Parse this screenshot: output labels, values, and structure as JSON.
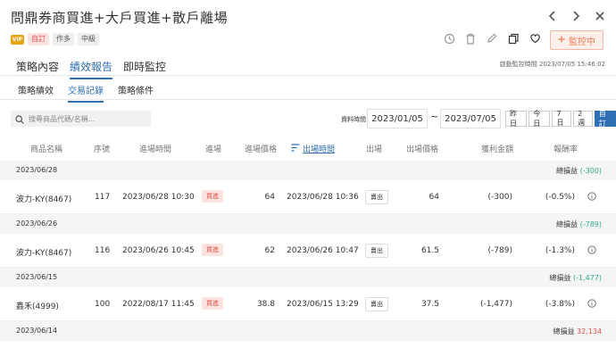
{
  "header": {
    "title": "問鼎券商買進+大戶買進+散戶離場",
    "prev_icon": "chevron-left-icon",
    "next_icon": "chevron-right-icon",
    "close_icon": "close-icon"
  },
  "tags": {
    "vip": "VIP",
    "custom": "自訂",
    "author": "作多",
    "level": "中級"
  },
  "actions": {
    "monitor_label": "監控中",
    "icons": [
      "history-icon",
      "trash-icon",
      "edit-icon",
      "copy-icon",
      "heart-icon"
    ]
  },
  "main_tabs": [
    {
      "label": "策略內容",
      "active": false
    },
    {
      "label": "績效報告",
      "active": true
    },
    {
      "label": "即時監控",
      "active": false
    }
  ],
  "monitor_time": "啟動監控時間 2023/07/05 15:46:02",
  "sub_tabs": [
    {
      "label": "策略績效",
      "active": false
    },
    {
      "label": "交易記錄",
      "active": true
    },
    {
      "label": "策略條件",
      "active": false
    }
  ],
  "search": {
    "placeholder": "搜尋商品代碼/名稱..."
  },
  "date_filter": {
    "label": "資料時間",
    "start": "2023/01/05",
    "separator": "~",
    "end": "2023/07/05",
    "ranges": [
      {
        "label": "昨日",
        "active": false
      },
      {
        "label": "今日",
        "active": false
      },
      {
        "label": "7日",
        "active": false
      },
      {
        "label": "2週",
        "active": false
      },
      {
        "label": "自訂",
        "active": true
      }
    ]
  },
  "table": {
    "columns": [
      "商品名稱",
      "序號",
      "進場時間",
      "進場",
      "進場價格",
      "出場時間",
      "出場",
      "出場價格",
      "獲利金額",
      "報酬率"
    ],
    "sort_column": "出場時間",
    "groups": [
      {
        "date": "2023/06/28",
        "summary_label": "總損益",
        "summary_value": "(-300)",
        "summary_sign": "neg",
        "rows": [
          {
            "name": "波力-KY(8467)",
            "seq": "117",
            "entry_time": "2023/06/28 10:30",
            "entry": "買進",
            "entry_price": "64",
            "exit_time": "2023/06/28 10:36",
            "exit": "賣出",
            "exit_price": "64",
            "profit": "(-300)",
            "return": "(-0.5%)"
          }
        ]
      },
      {
        "date": "2023/06/26",
        "summary_label": "總損益",
        "summary_value": "(-789)",
        "summary_sign": "neg",
        "rows": [
          {
            "name": "波力-KY(8467)",
            "seq": "116",
            "entry_time": "2023/06/26 10:45",
            "entry": "買進",
            "entry_price": "62",
            "exit_time": "2023/06/26 10:47",
            "exit": "賣出",
            "exit_price": "61.5",
            "profit": "(-789)",
            "return": "(-1.3%)"
          }
        ]
      },
      {
        "date": "2023/06/15",
        "summary_label": "總損益",
        "summary_value": "(-1,477)",
        "summary_sign": "neg",
        "rows": [
          {
            "name": "鑫禾(4999)",
            "seq": "100",
            "entry_time": "2022/08/17 11:45",
            "entry": "買進",
            "entry_price": "38.8",
            "exit_time": "2023/06/15 13:29",
            "exit": "賣出",
            "exit_price": "37.5",
            "profit": "(-1,477)",
            "return": "(-3.8%)"
          }
        ]
      },
      {
        "date": "2023/06/14",
        "summary_label": "總損益",
        "summary_value": "32,134",
        "summary_sign": "pos",
        "rows": []
      }
    ]
  },
  "colors": {
    "accent": "#2f6fb5",
    "loss": "#34a98c",
    "gain": "#e2504a",
    "buy_bg": "#fde3df",
    "monitor_border": "#f5b9a6"
  }
}
